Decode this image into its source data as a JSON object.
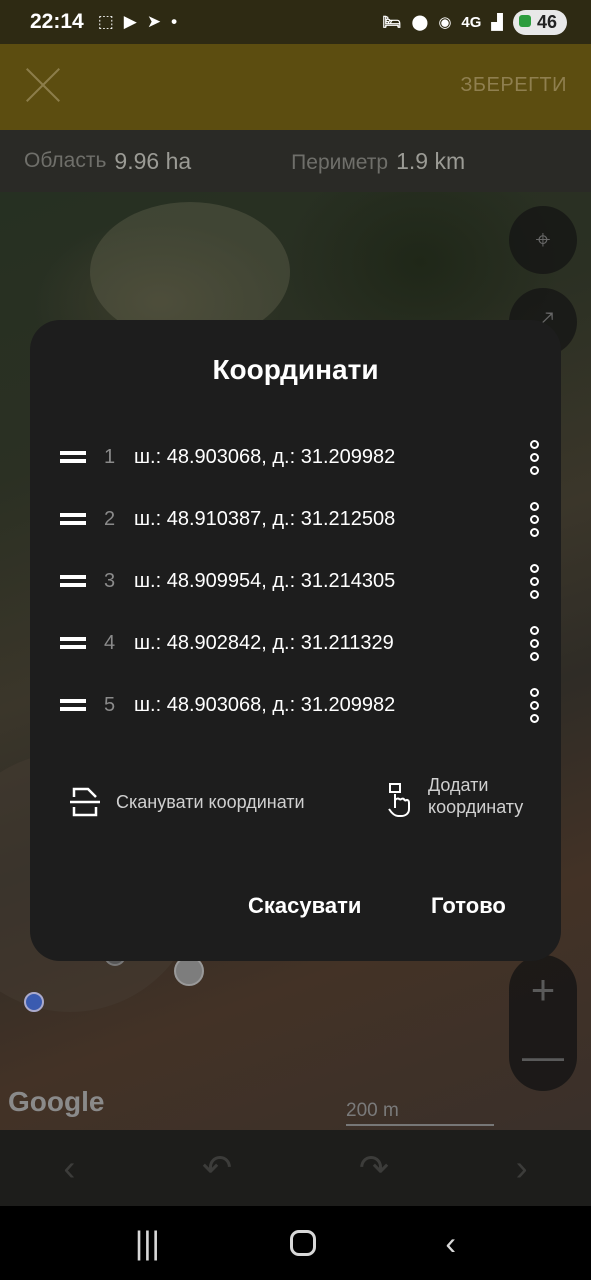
{
  "status_bar": {
    "time": "22:14",
    "network": "4G",
    "battery": "46"
  },
  "app_bar": {
    "save_label": "ЗБЕРЕГТИ"
  },
  "stats": {
    "area_label": "Область",
    "area_value": "9.96 ha",
    "perimeter_label": "Периметр",
    "perimeter_value": "1.9 km"
  },
  "map": {
    "google_label": "Google",
    "scale_label": "200 m"
  },
  "dialog": {
    "title": "Координати",
    "rows": [
      {
        "index": "1",
        "text": "ш.: 48.903068, д.: 31.209982"
      },
      {
        "index": "2",
        "text": "ш.: 48.910387, д.: 31.212508"
      },
      {
        "index": "3",
        "text": "ш.: 48.909954, д.: 31.214305"
      },
      {
        "index": "4",
        "text": "ш.: 48.902842, д.: 31.211329"
      },
      {
        "index": "5",
        "text": "ш.: 48.903068, д.: 31.209982"
      }
    ],
    "scan_label": "Сканувати координати",
    "add_label": "Додати координату",
    "cancel_label": "Скасувати",
    "done_label": "Готово"
  },
  "colors": {
    "app_bar": "#5c4d10",
    "dialog_bg": "#1d1d1d",
    "accent_dot": "#3a6fd8"
  }
}
